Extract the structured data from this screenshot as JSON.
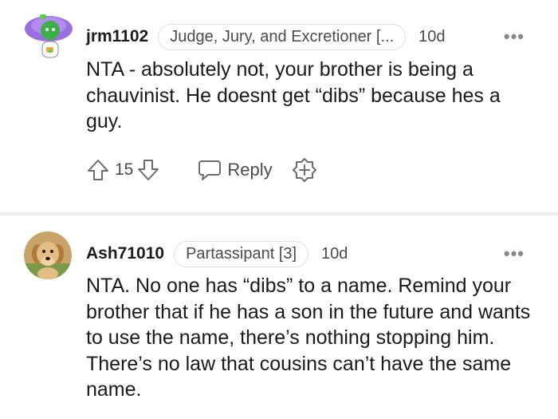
{
  "comments": [
    {
      "username": "jrm1102",
      "flair": "Judge, Jury, and Excretioner [...",
      "age": "10d",
      "more": "•••",
      "body": "NTA - absolutely not, your brother is being a chauvinist. He doesnt get “dibs” because hes a guy.",
      "score": "15",
      "reply_label": "Reply",
      "avatar": "reddit-snoo-avatar-green"
    },
    {
      "username": "Ash71010",
      "flair": "Partassipant [3]",
      "age": "10d",
      "more": "•••",
      "body": "NTA. No one has “dibs” to a name. Remind your brother that if he has a son in the future and wants to use the name, there’s nothing stopping him. There’s no law that cousins can’t have the same name.",
      "avatar": "golden-puppy-photo"
    }
  ],
  "colors": {
    "text": "#1a1a1b",
    "muted": "#4a4b4c",
    "flair_border": "#dcdfe2",
    "divider": "#edeff1",
    "snoo_purple": "#8b5fd6",
    "snoo_green": "#46d160"
  }
}
